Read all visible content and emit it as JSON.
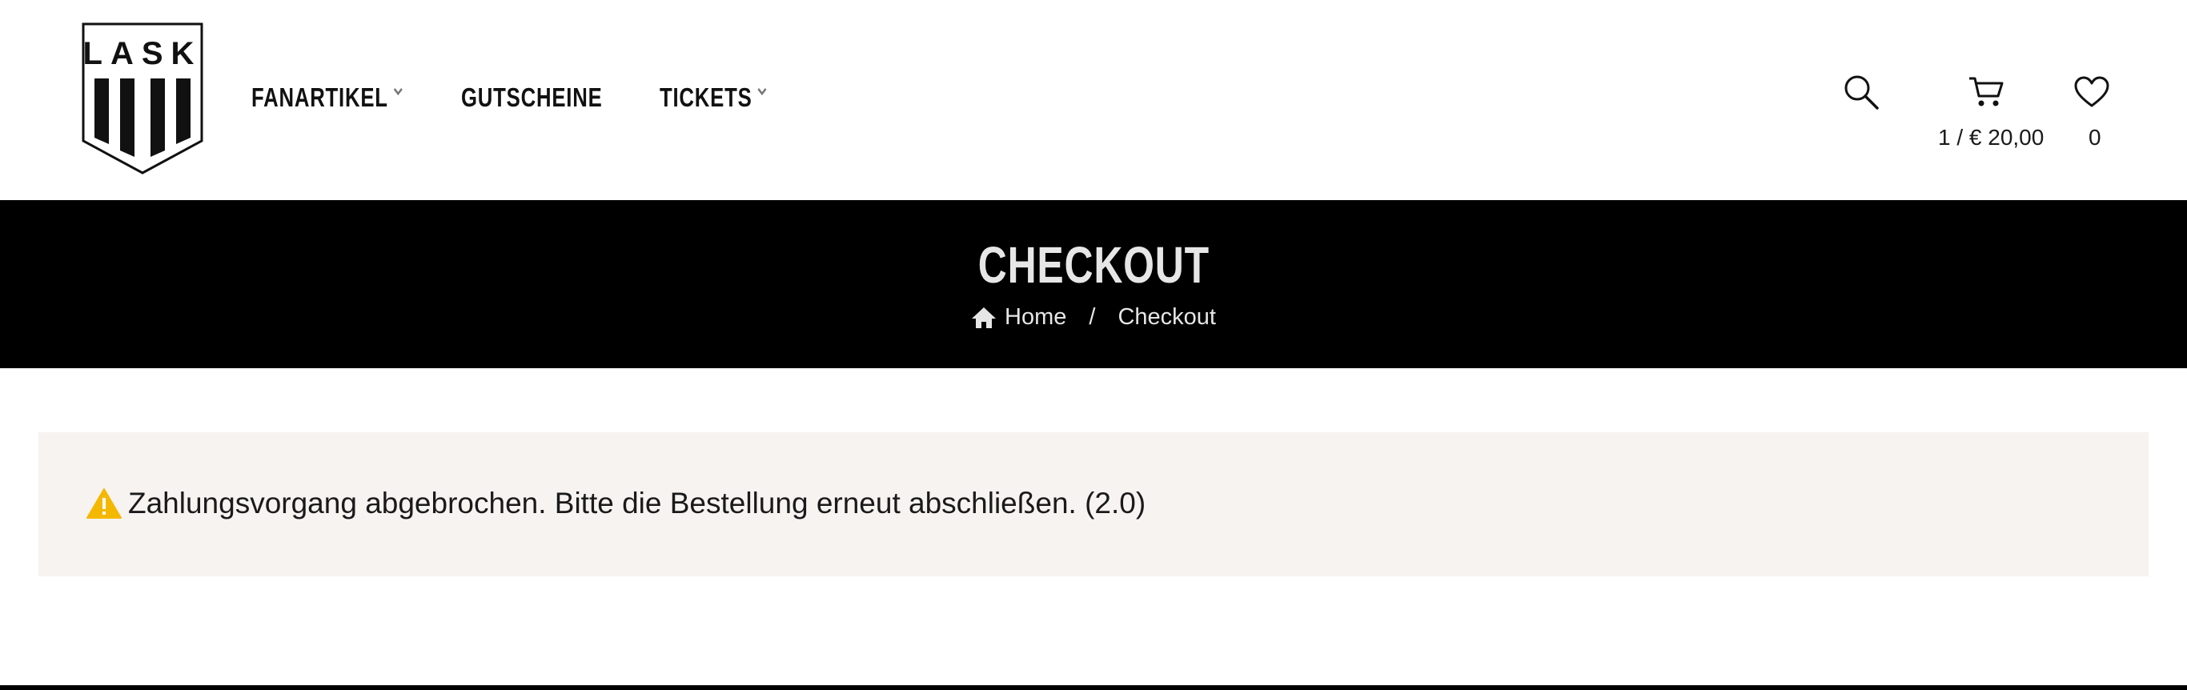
{
  "logo": {
    "text": "LASK"
  },
  "nav": {
    "items": [
      {
        "label": "FANARTIKEL",
        "has_dropdown": true
      },
      {
        "label": "GUTSCHEINE",
        "has_dropdown": false
      },
      {
        "label": "TICKETS",
        "has_dropdown": true
      }
    ]
  },
  "header_actions": {
    "search_icon": "search-icon",
    "cart": {
      "icon": "cart-icon",
      "summary": "1 / € 20,00"
    },
    "wishlist": {
      "icon": "heart-icon",
      "count": "0"
    }
  },
  "banner": {
    "title": "CHECKOUT",
    "breadcrumb": {
      "home": "Home",
      "separator": "/",
      "current": "Checkout"
    }
  },
  "notice": {
    "icon": "warning-icon",
    "text": "Zahlungsvorgang abgebrochen. Bitte die Bestellung erneut abschließen. (2.0)"
  },
  "colors": {
    "banner_bg": "#000000",
    "banner_text": "#e6e6e6",
    "notice_bg": "#f6f3f1",
    "warning": "#f5b800"
  }
}
